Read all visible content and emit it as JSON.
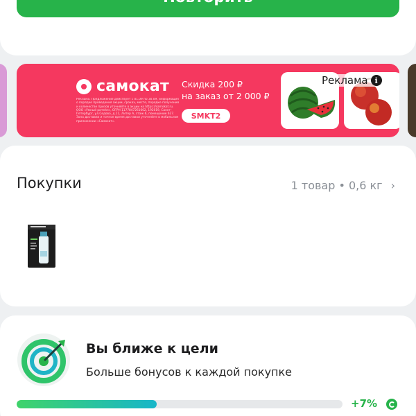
{
  "repeat_button": {
    "label": "Повторить"
  },
  "ad": {
    "brand": "самокат",
    "headline_line1": "Скидка 200 ₽",
    "headline_line2": "на заказ от 2 000 ₽",
    "promo_code": "SMKT2",
    "fineprint": "Реклама. Предложение действует с 01.09 по 30.09, информация о порядке проведения акции, сроках, месте, порядке получения и количестве призов уточняйте в акции на https://samokat.ru. ООО «Умный ритейл», ОГРН 1177847261602, 192019, Санкт-Петербург, ул.Седова, д.11, Литер А, этаж 6, помещение 627. Зона доставки и точное время доставки уточняйте в мобильном приложении «Самокат».",
    "label": "Реклама",
    "info_icon": "info-icon"
  },
  "purchases": {
    "title": "Покупки",
    "summary": "1 товар • 0,6 кг",
    "chevron": "›"
  },
  "bonus": {
    "title": "Вы ближе к цели",
    "subtitle": "Больше бонусов к каждой покупке",
    "progress_fraction": 0.43,
    "percent_text": "+7%"
  },
  "colors": {
    "accent_green": "#27b34a",
    "ad_red": "#f5385f",
    "muted_text": "#8a8f96"
  }
}
